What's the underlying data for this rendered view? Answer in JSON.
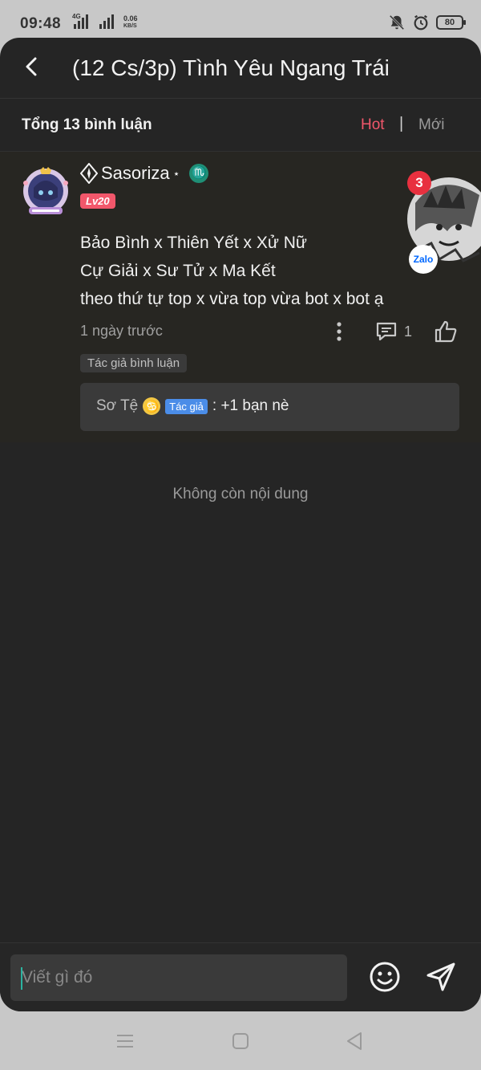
{
  "status_bar": {
    "time": "09:48",
    "network": "4G",
    "speed_value": "0.06",
    "speed_unit": "KB/S",
    "battery": "80"
  },
  "header": {
    "title": "(12 Cs/3p) Tình Yêu Ngang Trái"
  },
  "sort": {
    "total": "Tổng 13 bình luận",
    "hot": "Hot",
    "separator": "|",
    "new": "Mới"
  },
  "comment": {
    "username": "Sasoriza",
    "zodiac_symbol": "♏",
    "level": "Lv20",
    "lines": [
      "Bảo Bình x Thiên Yết x Xử Nữ",
      "Cự Giải x Sư Tử x Ma Kết",
      "theo thứ tự top x vừa top vừa bot x bot ạ"
    ],
    "time": "1 ngày trước",
    "reply_count": "1",
    "author_tag": "Tác giả bình luận",
    "reply": {
      "name": "Sơ Tệ",
      "zodiac_symbol": "♋",
      "badge": "Tác giả",
      "text": ": +1 bạn nè"
    }
  },
  "zalo_bubble": {
    "count": "3",
    "label": "Zalo"
  },
  "empty_text": "Không còn nội dung",
  "composer": {
    "placeholder": "Viết gì đó"
  },
  "colors": {
    "accent": "#f2576b",
    "badge_blue": "#4b8de8",
    "zodiac_green": "#1f8f76",
    "background": "#252525"
  }
}
